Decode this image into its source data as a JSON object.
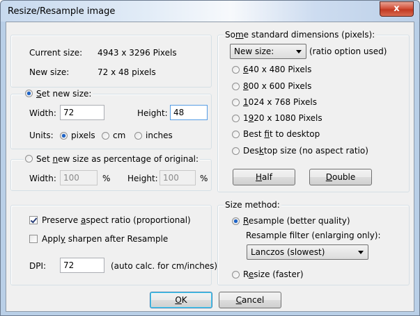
{
  "window": {
    "title": "Resize/Resample image",
    "close_label": "x"
  },
  "size_info": {
    "current_label": "Current size:",
    "current_value": "4943  x  3296  Pixels",
    "new_label": "New size:",
    "new_value": "72  x  48  pixels"
  },
  "set_new_size": {
    "radio_a": "S",
    "radio_b": "et new size:",
    "width_label": "Width:",
    "width_value": "72",
    "height_label": "Height:",
    "height_value": "48",
    "units_label": "Units:",
    "unit_pixels": "pixels",
    "unit_cm": "cm",
    "unit_inches": "inches"
  },
  "percent": {
    "radio_a": "Set ",
    "radio_u": "n",
    "radio_b": "ew size as percentage of original:",
    "width_label": "Width:",
    "width_value": "100",
    "width_unit": "%",
    "height_label": "Height:",
    "height_value": "100",
    "height_unit": "%"
  },
  "options": {
    "preserve_a": "Preserve ",
    "preserve_u": "a",
    "preserve_b": "spect ratio (proportional)",
    "sharpen_a": "Appl",
    "sharpen_u": "y",
    "sharpen_b": " sharpen after Resample",
    "dpi_label": "DPI:",
    "dpi_value": "72",
    "dpi_note": "(auto calc. for cm/inches)"
  },
  "standard": {
    "title_a": "So",
    "title_u": "m",
    "title_b": "e standard dimensions (pixels):",
    "dropdown_value": "New size:",
    "dropdown_note": "(ratio option used)",
    "items": [
      {
        "u": "6",
        "rest": "40 x 480 Pixels"
      },
      {
        "u": "8",
        "rest": "00 x 600 Pixels"
      },
      {
        "u": "1",
        "rest": "024 x 768 Pixels"
      },
      {
        "pre": "1",
        "u": "9",
        "rest": "20 x 1080 Pixels"
      },
      {
        "pre": "Best ",
        "u": "f",
        "rest": "it to desktop"
      },
      {
        "pre": "Des",
        "u": "k",
        "rest": "top size (no aspect ratio)"
      }
    ],
    "half_u": "H",
    "half_rest": "alf",
    "double_u": "D",
    "double_rest": "ouble"
  },
  "method": {
    "title": "Size method:",
    "resample_u": "R",
    "resample_rest": "esample (better quality)",
    "filter_label": "Resample filter (enlarging only):",
    "filter_value": "Lanczos (slowest)",
    "resize_pre": "R",
    "resize_u": "e",
    "resize_rest": "size (faster)"
  },
  "buttons": {
    "ok_u": "O",
    "ok_rest": "K",
    "cancel_u": "C",
    "cancel_rest": "ancel"
  },
  "colors": {
    "accent": "#1c63c8",
    "close": "#c23a22",
    "focus": "#569de5"
  }
}
